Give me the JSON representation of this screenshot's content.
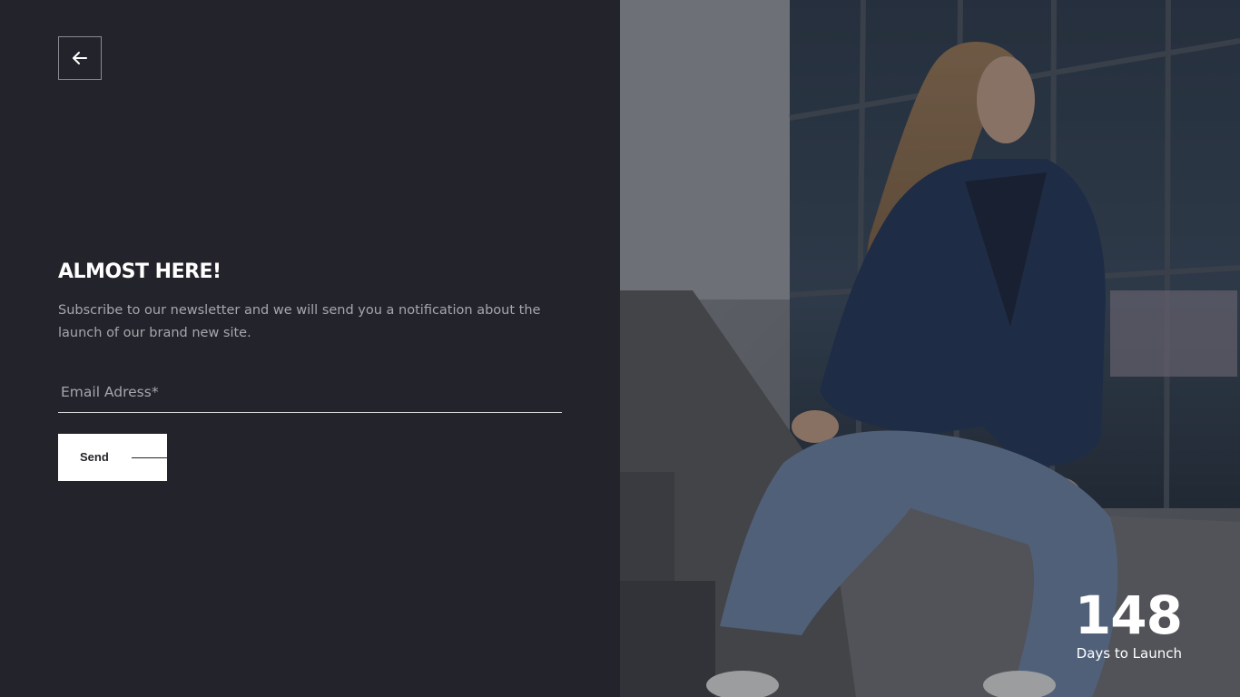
{
  "back": {
    "icon": "arrow-left-icon"
  },
  "signup": {
    "title": "ALMOST HERE!",
    "description": "Subscribe to our newsletter and we will send you a notification about the launch of our brand new site.",
    "email_placeholder": "Email Adress*",
    "email_value": "",
    "send_label": "Send"
  },
  "countdown": {
    "number": "148",
    "label": "Days to Launch"
  },
  "colors": {
    "background": "#23232b",
    "text_primary": "#ffffff",
    "text_muted": "#a6a6ad",
    "button_bg": "#ffffff"
  },
  "photo": {
    "icon": "woman-in-denim-photo"
  }
}
